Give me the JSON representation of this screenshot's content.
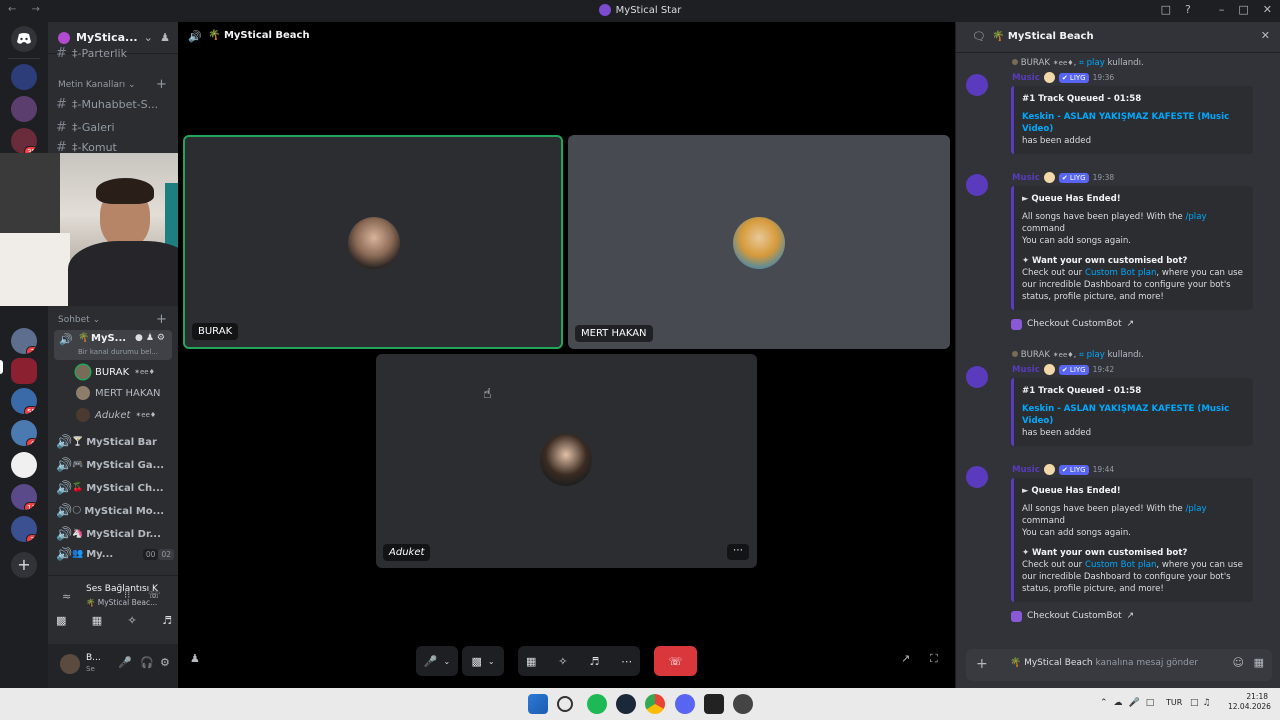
{
  "window": {
    "title": "MyStical Star"
  },
  "server": {
    "name": "MyStica...",
    "voice_channel_title": "MyStical Beach"
  },
  "channel_list": {
    "top_partial": "‡-Parterlik",
    "text_category": "Metin Kanalları",
    "text_channels": [
      "‡-Muhabbet-S...",
      "‡-Galeri",
      "‡-Komut"
    ],
    "voice_category": "Sohbet",
    "active_voice": {
      "name": "MyS...",
      "status": "Bir kanal durumu bel..."
    },
    "voice_users": [
      {
        "name": "BURAK",
        "tag": "✶ee♦"
      },
      {
        "name": "MERT HAKAN",
        "tag": ""
      },
      {
        "name": "Aduket",
        "tag": "✶ee♦"
      }
    ],
    "voice_channels": [
      {
        "name": "MyStical Bar",
        "emoji": "🍸"
      },
      {
        "name": "MyStical Ga...",
        "emoji": "🎮"
      },
      {
        "name": "MyStical Ch...",
        "emoji": "🍒"
      },
      {
        "name": "MyStical Mo...",
        "emoji": "🌕"
      },
      {
        "name": "MyStical Dr...",
        "emoji": "🦄"
      },
      {
        "name": "My...",
        "emoji": "👥",
        "counts": [
          "00",
          "02"
        ]
      }
    ]
  },
  "server_badges": [
    "39",
    "2",
    "55",
    "4",
    "11",
    "3"
  ],
  "connection": {
    "status": "Ses Bağlantısı K",
    "channel": "🌴 MyStical Beac..."
  },
  "user_panel": {
    "name": "B...",
    "sub": "Se"
  },
  "tiles": [
    {
      "name": "BURAK",
      "speaking": true
    },
    {
      "name": "MERT HAKAN",
      "speaking": false
    },
    {
      "name": "Aduket",
      "speaking": false
    }
  ],
  "chat": {
    "title": "MyStical Beach",
    "bot_name": "Music",
    "bot_tag": "✔ LIYG",
    "command_user": "BURAK",
    "command_user_tag": "✶ee♦",
    "command_name": "⌗ play",
    "command_suffix": "kullandı.",
    "messages": [
      {
        "time": "19:36",
        "kind": "queued",
        "with_command": true
      },
      {
        "time": "19:38",
        "kind": "ended",
        "with_command": false
      },
      {
        "time": "19:42",
        "kind": "queued",
        "with_command": true
      },
      {
        "time": "19:44",
        "kind": "ended",
        "with_command": false
      }
    ],
    "queued": {
      "title": "#1 Track Queued - 01:58",
      "song": "Keskin - ASLAN YAKIŞMAZ KAFESTE (Music Video)",
      "added": "has been added"
    },
    "ended": {
      "title": "Queue Has Ended!",
      "line1": "All songs have been played! With the",
      "cmd": "/play",
      "line1b": "command",
      "line2": "You can add songs again.",
      "promo_title": "Want your own customised bot?",
      "promo_a": "Check out our",
      "promo_link": "Custom Bot plan",
      "promo_b": ", where you can use our incredible Dashboard to configure your bot's status, profile picture, and more!",
      "button": "Checkout CustomBot"
    },
    "input_channel": "🌴 MyStical Beach",
    "input_placeholder": "kanalına mesaj gönder"
  },
  "taskbar": {
    "lang": "TUR",
    "time": "21:18",
    "date": "12.04.2026"
  },
  "colors": {
    "accent": "#5865f2",
    "speaking": "#23a55a",
    "danger": "#da373c",
    "link": "#00a8fc"
  }
}
